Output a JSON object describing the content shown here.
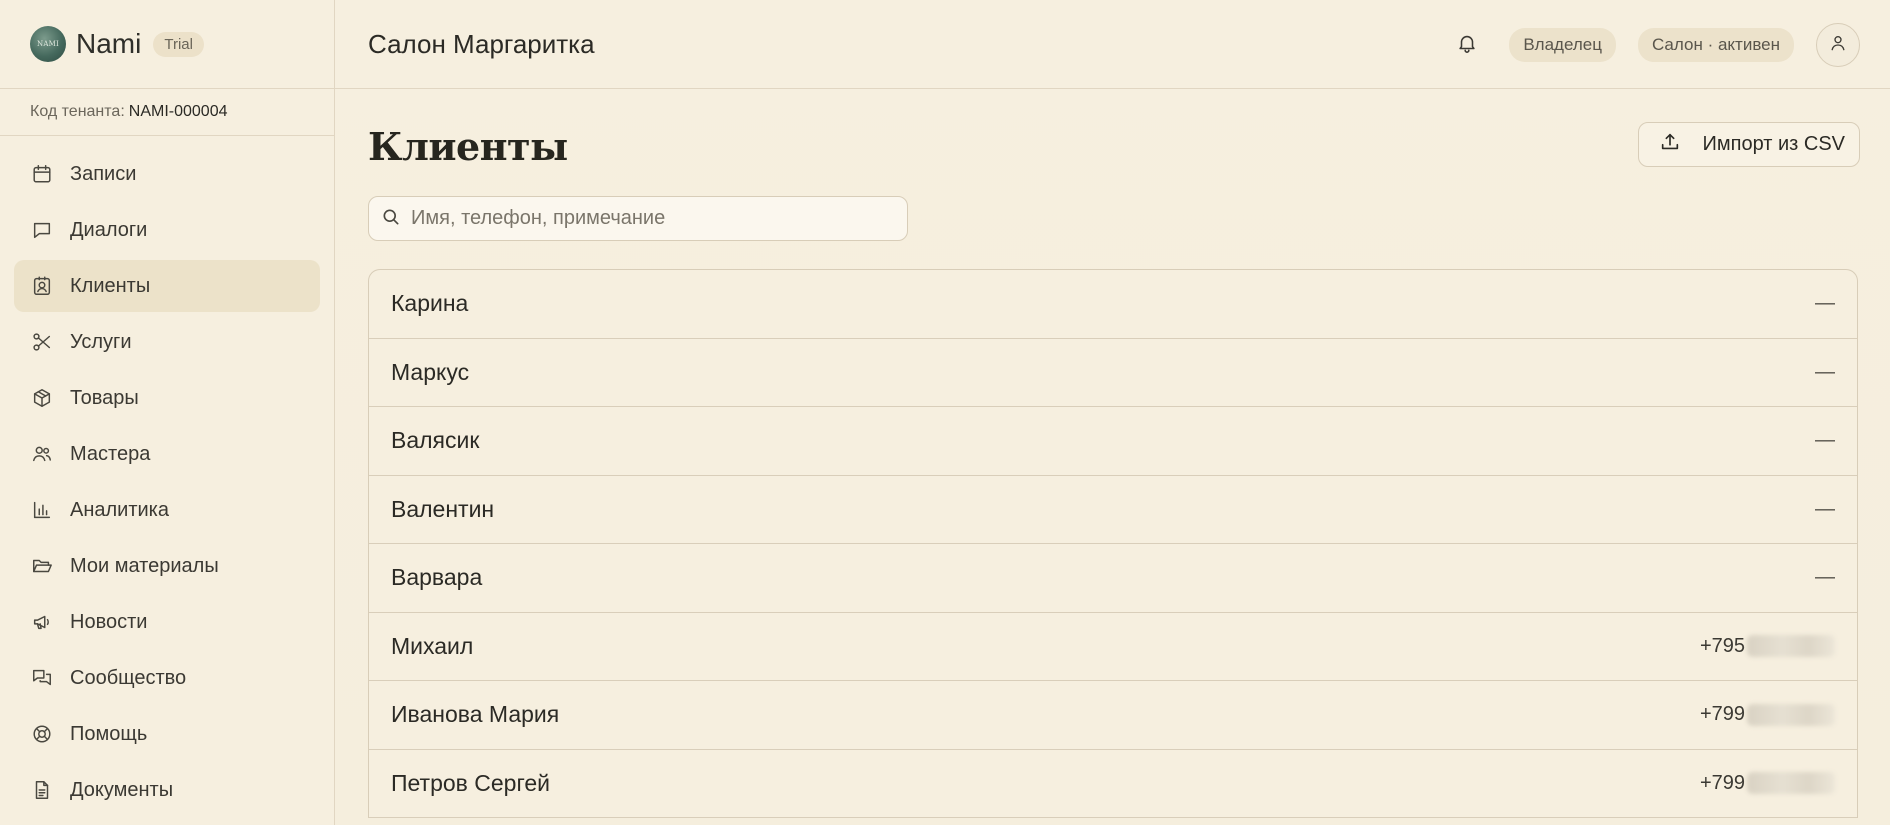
{
  "brand": {
    "logo_text": "NAMI",
    "name": "Nami",
    "badge": "Trial"
  },
  "tenant": {
    "label": "Код тенанта:",
    "code": "NAMI-000004"
  },
  "sidebar": {
    "items": [
      {
        "label": "Записи",
        "icon": "calendar-icon",
        "active": false
      },
      {
        "label": "Диалоги",
        "icon": "chat-bubble-icon",
        "active": false
      },
      {
        "label": "Клиенты",
        "icon": "contact-card-icon",
        "active": true
      },
      {
        "label": "Услуги",
        "icon": "scissors-icon",
        "active": false
      },
      {
        "label": "Товары",
        "icon": "package-icon",
        "active": false
      },
      {
        "label": "Мастера",
        "icon": "users-icon",
        "active": false
      },
      {
        "label": "Аналитика",
        "icon": "bar-chart-icon",
        "active": false
      },
      {
        "label": "Мои материалы",
        "icon": "folder-open-icon",
        "active": false
      },
      {
        "label": "Новости",
        "icon": "megaphone-icon",
        "active": false
      },
      {
        "label": "Сообщество",
        "icon": "messages-icon",
        "active": false
      },
      {
        "label": "Помощь",
        "icon": "lifebuoy-icon",
        "active": false
      },
      {
        "label": "Документы",
        "icon": "document-icon",
        "active": false
      }
    ]
  },
  "header": {
    "title": "Салон Маргаритка",
    "role_badge": "Владелец",
    "status_badge": "Салон · активен"
  },
  "main": {
    "title": "Клиенты",
    "import_label": "Импорт из CSV",
    "search_placeholder": "Имя, телефон, примечание"
  },
  "clients": [
    {
      "name": "Карина",
      "phone": "—",
      "blurred": false
    },
    {
      "name": "Маркус",
      "phone": "—",
      "blurred": false
    },
    {
      "name": "Валясик",
      "phone": "—",
      "blurred": false
    },
    {
      "name": "Валентин",
      "phone": "—",
      "blurred": false
    },
    {
      "name": "Варвара",
      "phone": "—",
      "blurred": false
    },
    {
      "name": "Михаил",
      "phone": "+795",
      "blurred": true
    },
    {
      "name": "Иванова Мария",
      "phone": "+799",
      "blurred": true
    },
    {
      "name": "Петров Сергей",
      "phone": "+799",
      "blurred": true
    }
  ],
  "colors": {
    "background": "#f6efdf",
    "active_nav": "#ece2c9",
    "border": "#d8cdb8",
    "badge": "#ece2cb"
  }
}
